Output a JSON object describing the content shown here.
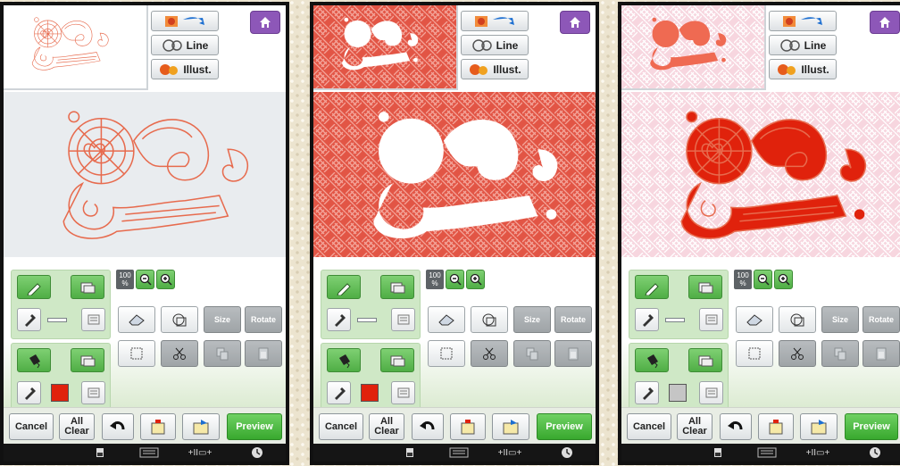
{
  "toolbar": {
    "line_label": "Line",
    "illust_label": "Illust."
  },
  "zoom": {
    "value": "100",
    "unit": "%"
  },
  "edit": {
    "size_label": "Size",
    "rotate_label": "Rotate"
  },
  "bottom": {
    "cancel_label": "Cancel",
    "allclear_line1": "All",
    "allclear_line2": "Clear",
    "preview_label": "Preview"
  },
  "status": {
    "frame_label": "+II▭+"
  },
  "screens": [
    {
      "name": "line-mode",
      "region_color": "#e0220c"
    },
    {
      "name": "region-mode",
      "region_color": "#e0220c"
    },
    {
      "name": "illustration-mode",
      "region_color": "#c5c5c5"
    }
  ],
  "colors": {
    "home_button": "#8d57b8",
    "green_button": "#4fae45",
    "preview_button": "#38a82e",
    "line_art": "#e76b4e",
    "fill_red": "#e0220c",
    "pink_pattern": "#f7c7d4"
  },
  "icons": [
    "home-icon",
    "pencil-icon",
    "eraser-icon",
    "eyedropper-icon",
    "paint-bucket-icon",
    "zoom-out-icon",
    "zoom-in-icon",
    "select-rect-icon",
    "scissors-icon",
    "undo-icon",
    "save-icon",
    "retrieve-icon",
    "memory-icon",
    "pattern-icon",
    "clock-icon"
  ]
}
